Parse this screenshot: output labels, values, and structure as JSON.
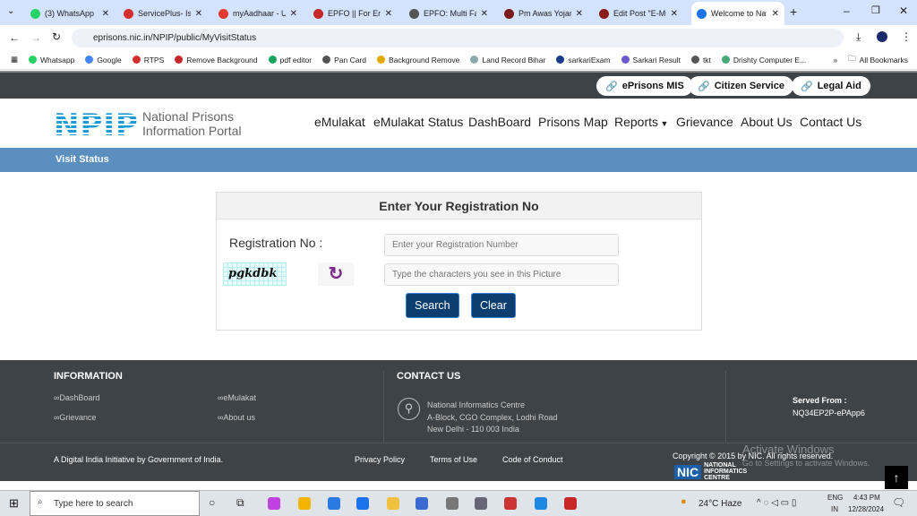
{
  "browser": {
    "tabs": [
      {
        "title": "(3) WhatsApp",
        "color": "#25d366"
      },
      {
        "title": "ServicePlus- Issu",
        "color": "#d32f2f"
      },
      {
        "title": "myAadhaar - Uni",
        "color": "#e53935"
      },
      {
        "title": "EPFO || For Empl",
        "color": "#c62828"
      },
      {
        "title": "EPFO: Multi Fact",
        "color": "#555555"
      },
      {
        "title": "Pm Awas Yojana",
        "color": "#7b1a1a"
      },
      {
        "title": "Edit Post \"E-Mul",
        "color": "#8b1a1a"
      },
      {
        "title": "Welcome to Nati",
        "color": "#1a73e8",
        "active": true
      }
    ],
    "url": "eprisons.nic.in/NPIP/public/MyVisitStatus",
    "bookmarks": [
      "Whatsapp",
      "Google",
      "RTPS",
      "Remove Background",
      "pdf editor",
      "Pan Card",
      "Background Remove",
      "Land Record Bihar",
      "sarkariExam",
      "Sarkari Result",
      "tkt",
      "Drishty Computer E..."
    ],
    "all_bookmarks": "All Bookmarks"
  },
  "topbar": {
    "links": [
      "ePrisons MIS",
      "Citizen Service",
      "Legal Aid"
    ]
  },
  "header": {
    "logo": "NPIP",
    "portal_line1": "National Prisons",
    "portal_line2": "Information Portal",
    "nav": [
      "eMulakat",
      "eMulakat Status",
      "DashBoard",
      "Prisons Map",
      "Reports",
      "Grievance",
      "About Us",
      "Contact Us"
    ]
  },
  "page_title": "Visit Status",
  "form": {
    "heading": "Enter Your Registration No",
    "reg_label": "Registration No :",
    "reg_placeholder": "Enter your Registration Number",
    "captcha_text": "pgkdbk",
    "captcha_placeholder": "Type the characters you see in this Picture",
    "search": "Search",
    "clear": "Clear"
  },
  "footer": {
    "info_title": "INFORMATION",
    "info_links": [
      "DashBoard",
      "eMulakat",
      "Grievance",
      "About us"
    ],
    "contact_title": "CONTACT US",
    "address": [
      "National Informatics Centre",
      "A-Block, CGO Complex, Lodhi Road",
      "New Delhi - 110 003 India"
    ],
    "served_from_label": "Served From :",
    "served_from": "NQ34EP2P-ePApp6",
    "digital_india": "A Digital India Initiative by Government of India.",
    "bottom_links": [
      "Privacy Policy",
      "Terms of Use",
      "Code of Conduct"
    ],
    "copyright": "Copyright © 2015 by NIC. All rights reserved.",
    "nic_logo": "NIC NATIONAL INFORMATICS CENTRE",
    "watermark1": "Activate Windows",
    "watermark2": "Go to Settings to activate Windows."
  },
  "taskbar": {
    "search_placeholder": "Type here to search",
    "weather": "24°C  Haze",
    "lang1": "ENG",
    "lang2": "IN",
    "time": "4:43 PM",
    "date": "12/28/2024"
  }
}
